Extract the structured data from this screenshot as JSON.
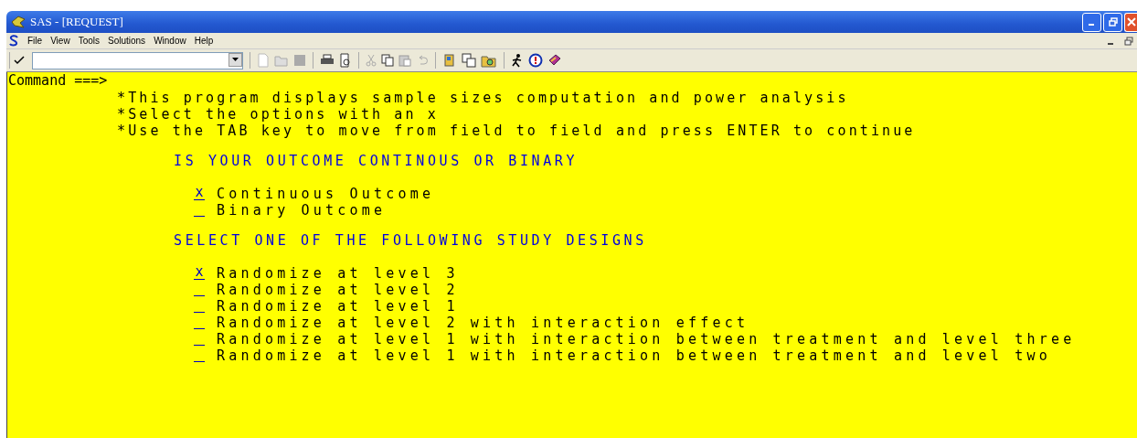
{
  "window": {
    "title": "SAS - [REQUEST]"
  },
  "menu": [
    "File",
    "View",
    "Tools",
    "Solutions",
    "Window",
    "Help"
  ],
  "command": {
    "prompt": "Command ===>"
  },
  "instructions": [
    "*This program displays sample sizes computation and power analysis",
    "*Select the options with an x",
    "*Use the TAB key to move from field to field and press ENTER to continue"
  ],
  "sections": [
    {
      "heading": "IS YOUR OUTCOME CONTINOUS OR BINARY",
      "options": [
        {
          "field": "x",
          "label": "Continuous Outcome"
        },
        {
          "label": "Binary Outcome"
        }
      ]
    },
    {
      "heading": "SELECT ONE OF THE FOLLOWING STUDY DESIGNS",
      "options": [
        {
          "field": "x",
          "label": "Randomize at level 3"
        },
        {
          "label": "Randomize at level 2"
        },
        {
          "label": "Randomize at level 1"
        },
        {
          "label": "Randomize at level 2 with interaction effect"
        },
        {
          "label": "Randomize at level 1 with interaction between treatment and level three"
        },
        {
          "label": "Randomize at level 1 with interaction between treatment and level two"
        }
      ]
    }
  ]
}
